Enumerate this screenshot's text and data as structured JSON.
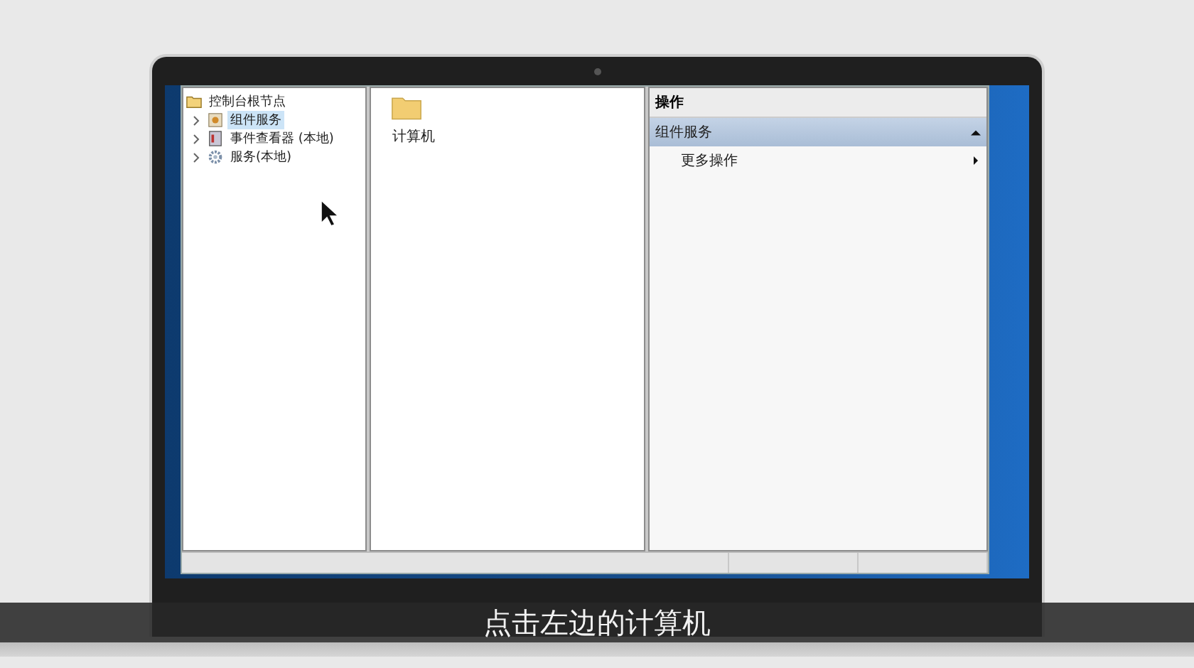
{
  "tree": {
    "label": "控制台根节点",
    "children": [
      {
        "label": "组件服务",
        "selected": true,
        "expanded": false,
        "kind": "component"
      },
      {
        "label": "事件查看器 (本地)",
        "selected": false,
        "expanded": false,
        "kind": "log"
      },
      {
        "label": "服务(本地)",
        "selected": false,
        "expanded": false,
        "kind": "service"
      }
    ]
  },
  "items": [
    {
      "label": "计算机",
      "selected": false
    }
  ],
  "actions": {
    "title": "操作",
    "section": {
      "label": "组件服务",
      "expanded": true
    },
    "entries": [
      {
        "label": "更多操作"
      }
    ]
  },
  "subtitle": "点击左边的计算机"
}
